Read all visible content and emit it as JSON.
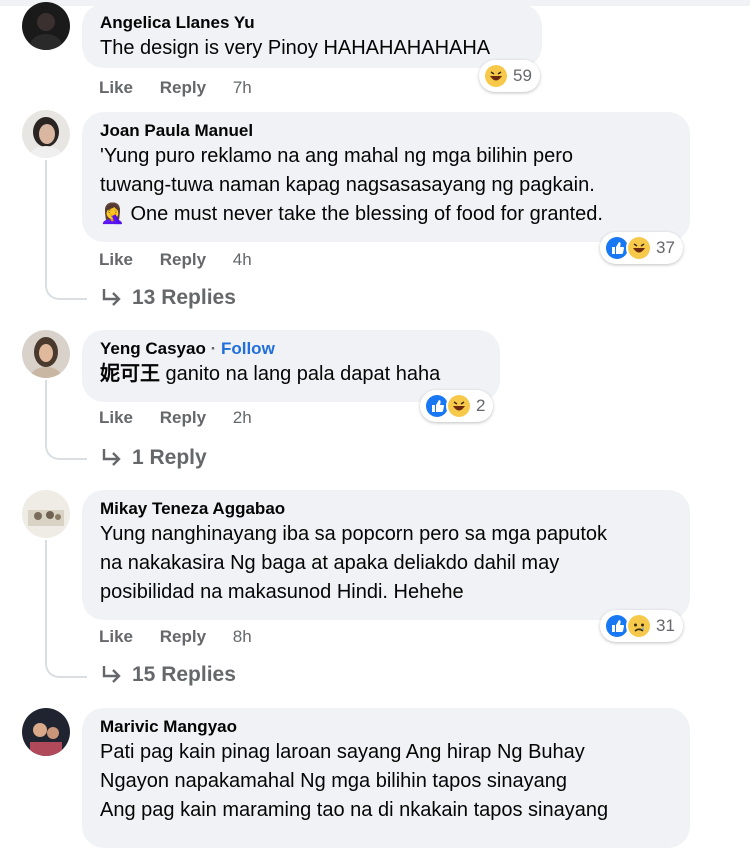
{
  "comments": [
    {
      "author": "Angelica Llanes Yu",
      "text": "The design is very Pinoy HAHAHAHAHAHA",
      "like": "Like",
      "reply": "Reply",
      "time": "7h",
      "reaction_count": "59",
      "reactions": [
        "haha-icon"
      ]
    },
    {
      "author": "Joan Paula Manuel",
      "text_line1": "'Yung puro reklamo na ang mahal ng mga bilihin pero",
      "text_line2": "tuwang-tuwa naman kapag nagsasasayang ng pagkain.",
      "text_line3": "One must never take the blessing of food for granted.",
      "emoji": "🤦‍♀️",
      "like": "Like",
      "reply": "Reply",
      "time": "4h",
      "reaction_count": "37",
      "reactions": [
        "like-icon",
        "haha-icon"
      ],
      "replies": "13 Replies"
    },
    {
      "author": "Yeng Casyao",
      "separator": "·",
      "follow": "Follow",
      "text_prefix": "妮可王",
      "text": " ganito na lang pala dapat haha",
      "like": "Like",
      "reply": "Reply",
      "time": "2h",
      "reaction_count": "2",
      "reactions": [
        "like-icon",
        "haha-icon"
      ],
      "replies": "1 Reply"
    },
    {
      "author": "Mikay Teneza Aggabao",
      "text_line1": "Yung nanghinayang iba sa popcorn pero sa mga paputok",
      "text_line2": "na nakakasira Ng baga at apaka deliakdo dahil may",
      "text_line3": "posibilidad na makasunod Hindi. Hehehe",
      "like": "Like",
      "reply": "Reply",
      "time": "8h",
      "reaction_count": "31",
      "reactions": [
        "like-icon",
        "sad-icon"
      ],
      "replies": "15 Replies"
    },
    {
      "author": "Marivic Mangyao",
      "text_line1": "Pati pag kain pinag laroan sayang Ang hirap Ng Buhay",
      "text_line2": "Ngayon napakamahal Ng mga bilihin tapos sinayang",
      "text_line3": "Ang pag kain maraming tao na di nkakain tapos sinayang"
    }
  ],
  "colors": {
    "bubble": "#f0f2f5",
    "link": "#216fdb",
    "meta": "#65676b",
    "like_blue": "#1877f2",
    "haha_yellow": "#f7c94b"
  }
}
